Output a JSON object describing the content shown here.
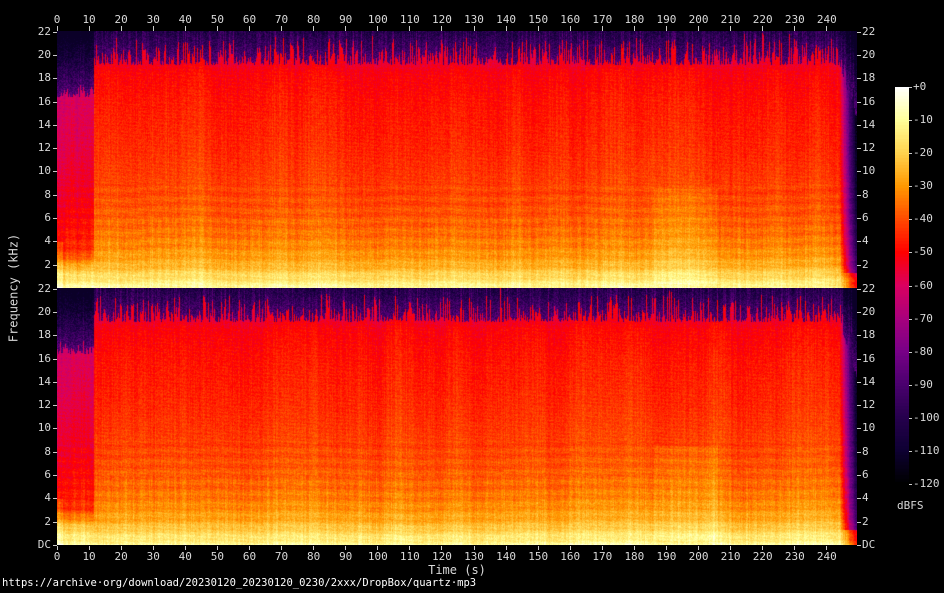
{
  "url_caption": "https://archive·org/download/20230120_20230120_0230/2xxx/DropBox/quartz·mp3",
  "axes": {
    "time_title": "Time (s)",
    "freq_title": "Frequency (kHz)",
    "dc_label": "DC",
    "time_tick_labels": [
      "0",
      "10",
      "20",
      "30",
      "40",
      "50",
      "60",
      "70",
      "80",
      "90",
      "100",
      "110",
      "120",
      "130",
      "140",
      "150",
      "160",
      "170",
      "180",
      "190",
      "200",
      "210",
      "220",
      "230",
      "240"
    ],
    "freq_tick_labels": [
      "22",
      "20",
      "18",
      "16",
      "14",
      "12",
      "10",
      "8",
      "6",
      "4",
      "2"
    ]
  },
  "colorbar": {
    "title": "dBFS",
    "tick_labels": [
      "+0",
      "-10",
      "-20",
      "-30",
      "-40",
      "-50",
      "-60",
      "-70",
      "-80",
      "-90",
      "-100",
      "-110",
      "-120"
    ]
  },
  "chart_data": {
    "type": "heatmap",
    "subtype": "audio-spectrogram",
    "channels": 2,
    "x": {
      "label": "Time (s)",
      "min": 0,
      "max": 249.4,
      "major_tick_step": 10
    },
    "y": {
      "label": "Frequency (kHz)",
      "min": 0,
      "max": 22.05,
      "major_tick_step": 2,
      "min_label": "DC"
    },
    "z": {
      "label": "dBFS",
      "min": -120,
      "max": 0,
      "tick_step": 10
    },
    "palette": [
      {
        "db": 0,
        "color": "#FFFFFF"
      },
      {
        "db": -10,
        "color": "#FFFF99"
      },
      {
        "db": -20,
        "color": "#FFD24D"
      },
      {
        "db": -30,
        "color": "#FF9800"
      },
      {
        "db": -40,
        "color": "#FF4A00"
      },
      {
        "db": -50,
        "color": "#FF0000"
      },
      {
        "db": -60,
        "color": "#DB0060"
      },
      {
        "db": -70,
        "color": "#A8007D"
      },
      {
        "db": -80,
        "color": "#780087"
      },
      {
        "db": -90,
        "color": "#4A006E"
      },
      {
        "db": -100,
        "color": "#26004D"
      },
      {
        "db": -110,
        "color": "#0E0033"
      },
      {
        "db": -120,
        "color": "#000000"
      }
    ],
    "content": {
      "description": "Two-channel (stereo) spectrogram of an MP3: quiet intro until ~11.5 s, loud broadband music until ~244 s, then fade-out; MP3 low-pass cutoff near 19.2 kHz with spiky energy bursts up to ~21 kHz; bright low-frequency band below ~1.5 kHz for the whole duration",
      "duration_s": 249.4,
      "intro_quiet_until_s": 11.5,
      "lowpass_cutoff_khz": 19.2,
      "intro_cutoff_khz": 16.4,
      "fade_out_start_s": 243.8,
      "bright_patch_s": [
        186,
        206
      ],
      "level_vs_freq_db": [
        [
          0,
          -9
        ],
        [
          0.5,
          -14
        ],
        [
          1.2,
          -19
        ],
        [
          2,
          -26
        ],
        [
          3.5,
          -32
        ],
        [
          5,
          -36
        ],
        [
          8,
          -40
        ],
        [
          12,
          -44
        ],
        [
          16,
          -47
        ],
        [
          18.5,
          -50
        ],
        [
          19.2,
          -53
        ]
      ],
      "sections": [
        {
          "t_start": 0,
          "t_end": 11.5,
          "character": "quiet intro",
          "approx_level_db": -55,
          "hf_cutoff_khz": 16.4
        },
        {
          "t_start": 11.5,
          "t_end": 243.8,
          "character": "loud broadband music",
          "approx_level_db": -42,
          "hf_cutoff_khz": 19.2
        },
        {
          "t_start": 186,
          "t_end": 206,
          "character": "slightly louder low/mid passage",
          "approx_level_db": -38
        },
        {
          "t_start": 243.8,
          "t_end": 249.4,
          "character": "fade-out to silence"
        }
      ]
    }
  }
}
